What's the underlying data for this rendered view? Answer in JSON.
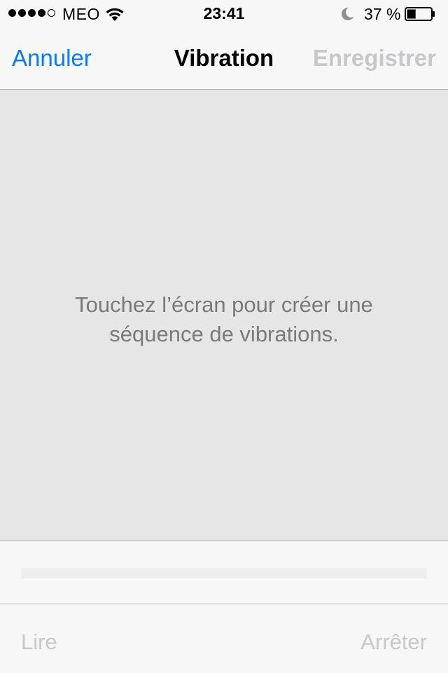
{
  "status_bar": {
    "signal_bars_filled": 4,
    "signal_bars_total": 5,
    "carrier": "MEO",
    "wifi_icon": "wifi-icon",
    "time": "23:41",
    "do_not_disturb_icon": "moon-icon",
    "battery_percent_label": "37 %",
    "battery_level": 0.37
  },
  "nav": {
    "cancel_label": "Annuler",
    "title": "Vibration",
    "save_label": "Enregistrer"
  },
  "touch_area": {
    "instruction": "Touchez l’écran pour créer une séquence de vibrations."
  },
  "progress": {
    "value": 0
  },
  "toolbar": {
    "play_label": "Lire",
    "stop_label": "Arrêter"
  },
  "colors": {
    "accent": "#0a7aff",
    "disabled": "#c7c7cc",
    "touch_area_bg": "#e6e6e6",
    "instruction_text": "#7a7a7a"
  }
}
